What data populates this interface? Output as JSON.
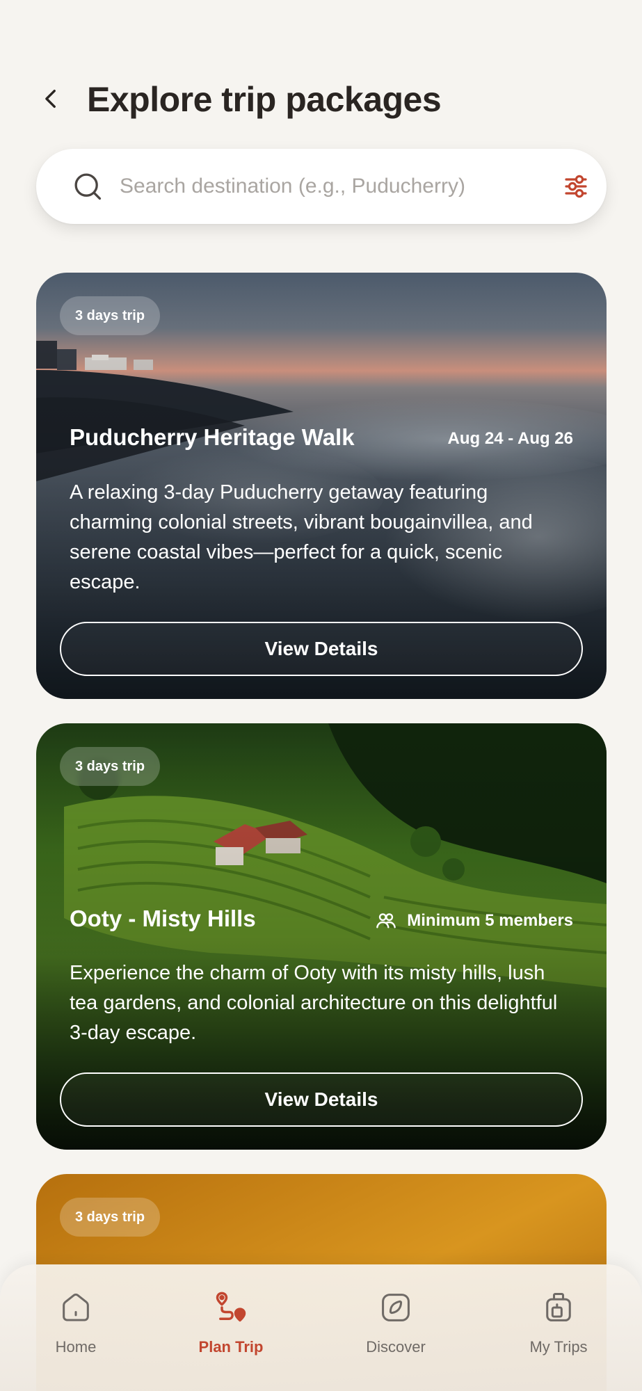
{
  "header": {
    "title": "Explore trip packages",
    "back_icon": "chevron-left-icon"
  },
  "search": {
    "placeholder": "Search destination (e.g., Puducherry)",
    "value": "",
    "search_icon": "search-icon",
    "filter_icon": "sliders-icon"
  },
  "packages": [
    {
      "duration": "3 days trip",
      "title": "Puducherry Heritage Walk",
      "meta": "Aug 24 - Aug 26",
      "description": "A relaxing 3-day Puducherry getaway featuring charming colonial streets, vibrant bougainvillea, and serene coastal vibes—perfect for a quick, scenic escape.",
      "button": "View Details"
    },
    {
      "duration": "3 days trip",
      "title": "Ooty - Misty Hills",
      "meta": "Minimum 5 members",
      "meta_icon": "group-icon",
      "description": "Experience the charm of Ooty with its misty hills, lush tea gardens, and colonial architecture on this delightful 3-day escape.",
      "button": "View Details"
    },
    {
      "duration": "3 days trip"
    }
  ],
  "bottom_nav": [
    {
      "label": "Home",
      "icon": "home-icon",
      "active": false
    },
    {
      "label": "Plan Trip",
      "icon": "route-icon",
      "active": true
    },
    {
      "label": "Discover",
      "icon": "compass-icon",
      "active": false
    },
    {
      "label": "My Trips",
      "icon": "luggage-icon",
      "active": false
    }
  ],
  "colors": {
    "accent": "#c2462f",
    "background": "#f6f4f0",
    "text": "#2a2522"
  }
}
